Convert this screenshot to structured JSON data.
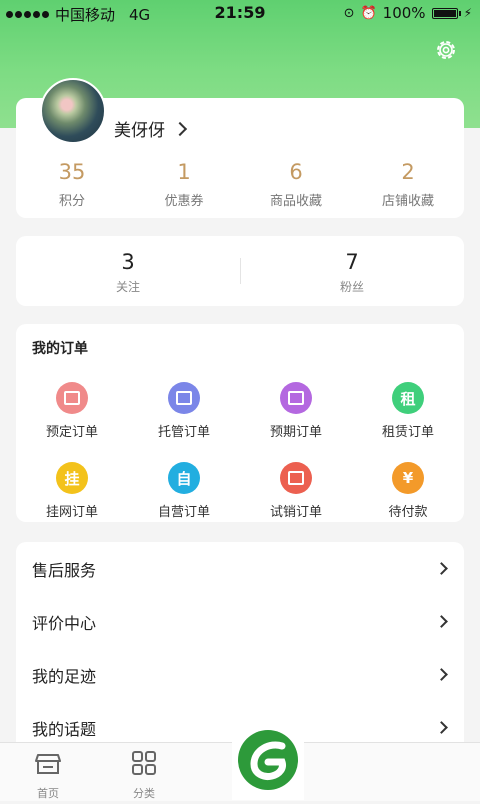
{
  "status_bar": {
    "carrier": "中国移动",
    "network": "4G",
    "time": "21:59",
    "battery": "100%"
  },
  "header": {
    "settings_icon": "gear-icon",
    "colors": {
      "accent": "#6fd679",
      "gold": "#c49a62"
    }
  },
  "profile": {
    "username": "美伢伢"
  },
  "stats": [
    {
      "value": "35",
      "label": "积分"
    },
    {
      "value": "1",
      "label": "优惠券"
    },
    {
      "value": "6",
      "label": "商品收藏"
    },
    {
      "value": "2",
      "label": "店铺收藏"
    }
  ],
  "follow": {
    "following_value": "3",
    "following_label": "关注",
    "fans_value": "7",
    "fans_label": "粉丝"
  },
  "orders": {
    "title": "我的订单",
    "items": [
      {
        "label": "预定订单",
        "icon": "calendar-icon",
        "color": "#f08a8a",
        "glyph": ""
      },
      {
        "label": "托管订单",
        "icon": "hand-icon",
        "color": "#7b86e8",
        "glyph": ""
      },
      {
        "label": "预期订单",
        "icon": "clock-icon",
        "color": "#b468e0",
        "glyph": ""
      },
      {
        "label": "租赁订单",
        "icon": "rent-icon",
        "color": "#3fcf7b",
        "glyph": "租"
      },
      {
        "label": "挂网订单",
        "icon": "hang-icon",
        "color": "#f3c21b",
        "glyph": "挂"
      },
      {
        "label": "自营订单",
        "icon": "self-icon",
        "color": "#22aee0",
        "glyph": "自"
      },
      {
        "label": "试销订单",
        "icon": "pen-icon",
        "color": "#ec6050",
        "glyph": ""
      },
      {
        "label": "待付款",
        "icon": "yuan-icon",
        "color": "#f39a2a",
        "glyph": "¥"
      }
    ]
  },
  "menu": [
    {
      "label": "售后服务"
    },
    {
      "label": "评价中心"
    },
    {
      "label": "我的足迹"
    },
    {
      "label": "我的话题"
    }
  ],
  "tabbar": [
    {
      "label": "首页",
      "icon": "store-icon"
    },
    {
      "label": "分类",
      "icon": "grid-icon"
    }
  ]
}
